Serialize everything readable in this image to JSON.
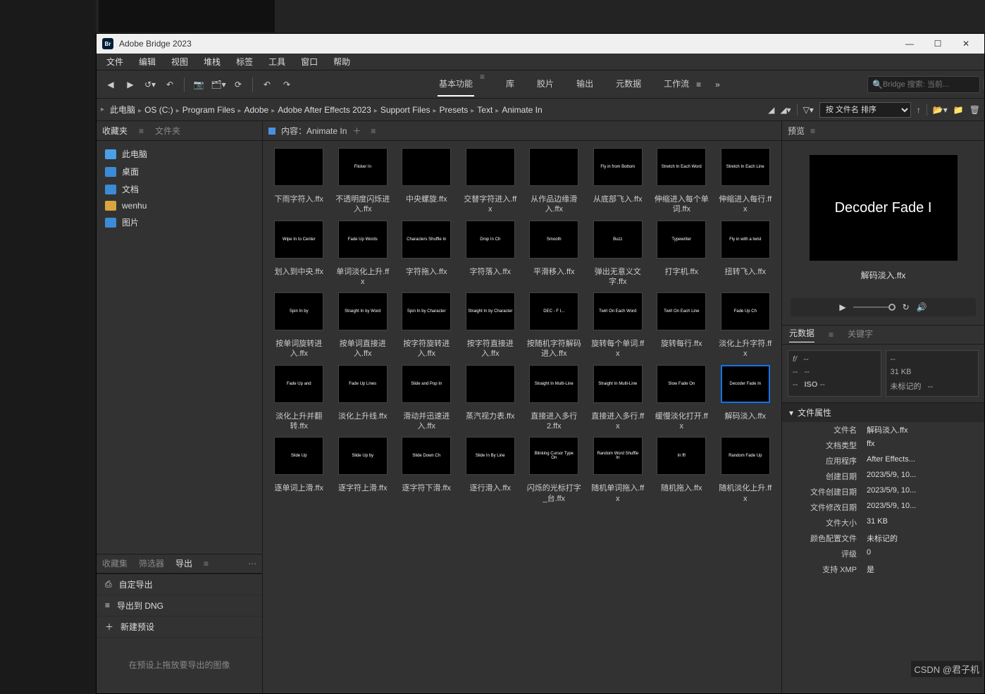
{
  "titlebar": {
    "app": "Adobe Bridge 2023"
  },
  "menu": [
    "文件",
    "编辑",
    "视图",
    "堆栈",
    "标签",
    "工具",
    "窗口",
    "帮助"
  ],
  "workspaces": {
    "items": [
      "基本功能",
      "库",
      "胶片",
      "输出",
      "元数据",
      "工作流"
    ],
    "active": 0
  },
  "search": {
    "placeholder": "Bridge 搜索: 当前..."
  },
  "breadcrumb": [
    "此电脑",
    "OS (C:)",
    "Program Files",
    "Adobe",
    "Adobe After Effects 2023",
    "Support Files",
    "Presets",
    "Text",
    "Animate In"
  ],
  "sort_select": "按 文件名 排序",
  "favorites": {
    "title": "收藏夹",
    "alt_tab": "文件夹",
    "items": [
      {
        "icon": "ic-pc",
        "label": "此电脑"
      },
      {
        "icon": "ic-desktop",
        "label": "桌面"
      },
      {
        "icon": "ic-doc",
        "label": "文档"
      },
      {
        "icon": "ic-folder",
        "label": "wenhu"
      },
      {
        "icon": "ic-pic",
        "label": "图片"
      }
    ]
  },
  "collections": {
    "tab1": "收藏集",
    "tab2": "筛选器",
    "tab3": "导出"
  },
  "export": {
    "items": [
      "自定导出",
      "导出到 DNG",
      "新建预设"
    ],
    "hint": "在预设上拖放要导出的图像"
  },
  "content_header": {
    "label": "内容：Animate In"
  },
  "grid_items": [
    {
      "thumb": "",
      "label": "下雨字符入.ffx"
    },
    {
      "thumb": "Flicker In",
      "label": "不透明度闪烁进入.ffx"
    },
    {
      "thumb": "",
      "label": "中央螺旋.ffx"
    },
    {
      "thumb": "",
      "label": "交替字符进入.ffx"
    },
    {
      "thumb": "",
      "label": "从作品边缘滑入.ffx"
    },
    {
      "thumb": "Fly in from Bottom",
      "label": "从底部飞入.ffx"
    },
    {
      "thumb": "Stretch In Each Word",
      "label": "伸缩进入每个单词.ffx"
    },
    {
      "thumb": "Stretch In Each Line",
      "label": "伸缩进入每行.ffx"
    },
    {
      "thumb": "Wipe In to Center",
      "label": "划入到中央.ffx"
    },
    {
      "thumb": "Fade Up Words",
      "label": "单词淡化上升.ffx"
    },
    {
      "thumb": "Characters Shuffle In",
      "label": "字符拖入.ffx"
    },
    {
      "thumb": "Drop In Ch",
      "label": "字符落入.ffx"
    },
    {
      "thumb": "Smooth",
      "label": "平滑移入.ffx"
    },
    {
      "thumb": "Buzz",
      "label": "弹出无意义文字.ffx"
    },
    {
      "thumb": "Typewriter",
      "label": "打字机.ffx"
    },
    {
      "thumb": "Fly in with a twist",
      "label": "扭转飞入.ffx"
    },
    {
      "thumb": "Spin In by",
      "label": "按单词旋转进入.ffx"
    },
    {
      "thumb": "Straight In by Word",
      "label": "按单词直接进入.ffx"
    },
    {
      "thumb": "Spin In by Character",
      "label": "按字符旋转进入.ffx"
    },
    {
      "thumb": "Straight In by Character",
      "label": "按字符直接进入.ffx"
    },
    {
      "thumb": "DEC - F I...",
      "label": "按随机字符解码进入.ffx"
    },
    {
      "thumb": "Twirl On Each Word",
      "label": "旋转每个单词.ffx"
    },
    {
      "thumb": "Twirl On Each Line",
      "label": "旋转每行.ffx"
    },
    {
      "thumb": "Fade Up Ch",
      "label": "淡化上升字符.ffx"
    },
    {
      "thumb": "Fade Up and",
      "label": "淡化上升并翻转.ffx"
    },
    {
      "thumb": "Fade Up Lines",
      "label": "淡化上升线.ffx"
    },
    {
      "thumb": "Slide and Pop In",
      "label": "滑动并迅速进入.ffx"
    },
    {
      "thumb": "",
      "label": "蒸汽视力表.ffx"
    },
    {
      "thumb": "Straight In Multi-Line",
      "label": "直接进入多行 2.ffx"
    },
    {
      "thumb": "Straight In Multi-Line",
      "label": "直接进入多行.ffx"
    },
    {
      "thumb": "Slow Fade On",
      "label": "缓慢淡化打开.ffx"
    },
    {
      "thumb": "Decoder Fade In",
      "label": "解码淡入.ffx",
      "selected": true
    },
    {
      "thumb": "Slide Up",
      "label": "逐单词上滑.ffx"
    },
    {
      "thumb": "Slide Up by",
      "label": "逐字符上滑.ffx"
    },
    {
      "thumb": "Slide Down Ch",
      "label": "逐字符下滑.ffx"
    },
    {
      "thumb": "Slide In By Line",
      "label": "逐行滑入.ffx"
    },
    {
      "thumb": "Blinking Cursor Type On",
      "label": "闪烁的光标打字_台.ffx"
    },
    {
      "thumb": "Random Word Shuffle In",
      "label": "随机单词拖入.ffx"
    },
    {
      "thumb": "In      ffl",
      "label": "随机拖入.ffx"
    },
    {
      "thumb": "Random Fade Up",
      "label": "随机淡化上升.ffx"
    }
  ],
  "preview": {
    "title": "预览",
    "img_text": "Decoder Fade I",
    "filename": "解码淡入.ffx"
  },
  "metadata": {
    "tab1": "元数据",
    "tab2": "关键字",
    "quick": {
      "fstop": "f/",
      "iso": "ISO",
      "size": "31 KB",
      "tag": "未标记的"
    },
    "section_title": "文件属性",
    "rows": [
      {
        "k": "文件名",
        "v": "解码淡入.ffx"
      },
      {
        "k": "文档类型",
        "v": "ffx"
      },
      {
        "k": "应用程序",
        "v": "After Effects..."
      },
      {
        "k": "创建日期",
        "v": "2023/5/9, 10..."
      },
      {
        "k": "文件创建日期",
        "v": "2023/5/9, 10..."
      },
      {
        "k": "文件修改日期",
        "v": "2023/5/9, 10..."
      },
      {
        "k": "文件大小",
        "v": "31 KB"
      },
      {
        "k": "颜色配置文件",
        "v": "未标记的"
      },
      {
        "k": "评级",
        "v": "0"
      },
      {
        "k": "支持 XMP",
        "v": "是"
      }
    ]
  },
  "watermark": "CSDN @君子机"
}
